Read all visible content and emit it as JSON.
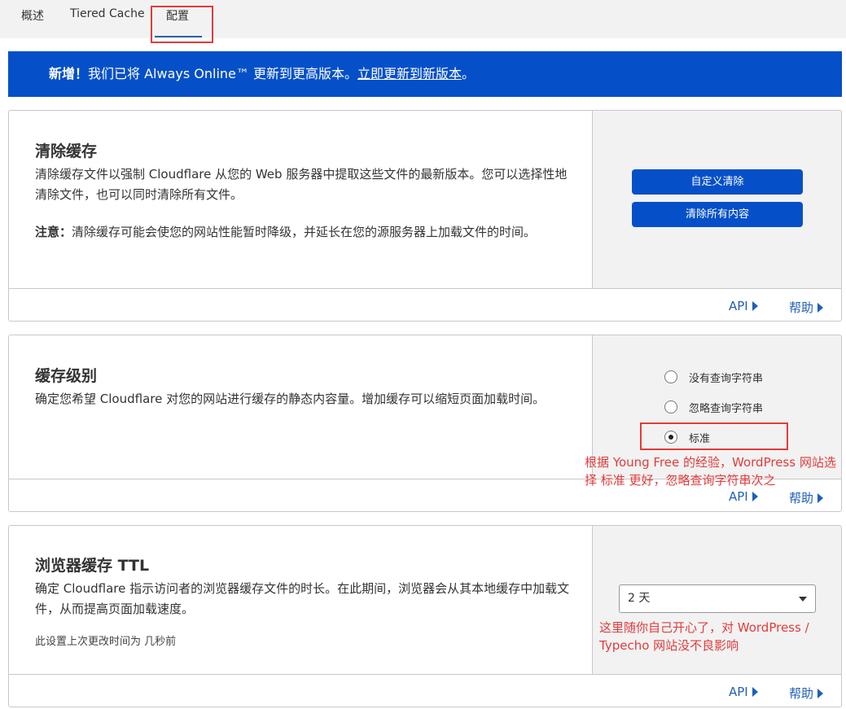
{
  "tabs": [
    {
      "label": "概述"
    },
    {
      "label": "Tiered Cache"
    },
    {
      "label": "配置"
    }
  ],
  "banner": {
    "prefix": "新增！",
    "text": "我们已将 Always Online™ 更新到更高版本。",
    "link": "立即更新到新版本",
    "suffix": "。"
  },
  "purge": {
    "title": "清除缓存",
    "desc": "清除缓存文件以强制 Cloudflare 从您的 Web 服务器中提取这些文件的最新版本。您可以选择性地清除文件，也可以同时清除所有文件。",
    "note_label": "注意：",
    "note_text": "清除缓存可能会使您的网站性能暂时降级，并延长在您的源服务器上加载文件的时间。",
    "custom_btn": "自定义清除",
    "all_btn": "清除所有内容",
    "api": "API",
    "help": "帮助"
  },
  "cache_level": {
    "title": "缓存级别",
    "desc": "确定您希望 Cloudflare 对您的网站进行缓存的静态内容量。增加缓存可以缩短页面加载时间。",
    "options": [
      "没有查询字符串",
      "忽略查询字符串",
      "标准"
    ],
    "selected": 2,
    "annotation": "根据 Young Free 的经验，WordPress 网站选择 标准 更好，忽略查询字符串次之",
    "api": "API",
    "help": "帮助"
  },
  "browser_ttl": {
    "title": "浏览器缓存 TTL",
    "desc": "确定 Cloudflare 指示访问者的浏览器缓存文件的时长。在此期间，浏览器会从其本地缓存中加载文件，从而提高页面加载速度。",
    "last_changed": "此设置上次更改时间为 几秒前",
    "selected": "2 天",
    "annotation": "这里随你自己开心了，对 WordPress / Typecho 网站没不良影响",
    "api": "API",
    "help": "帮助"
  },
  "colors": {
    "accent": "#0550c8",
    "annotation": "#e23b3b"
  }
}
